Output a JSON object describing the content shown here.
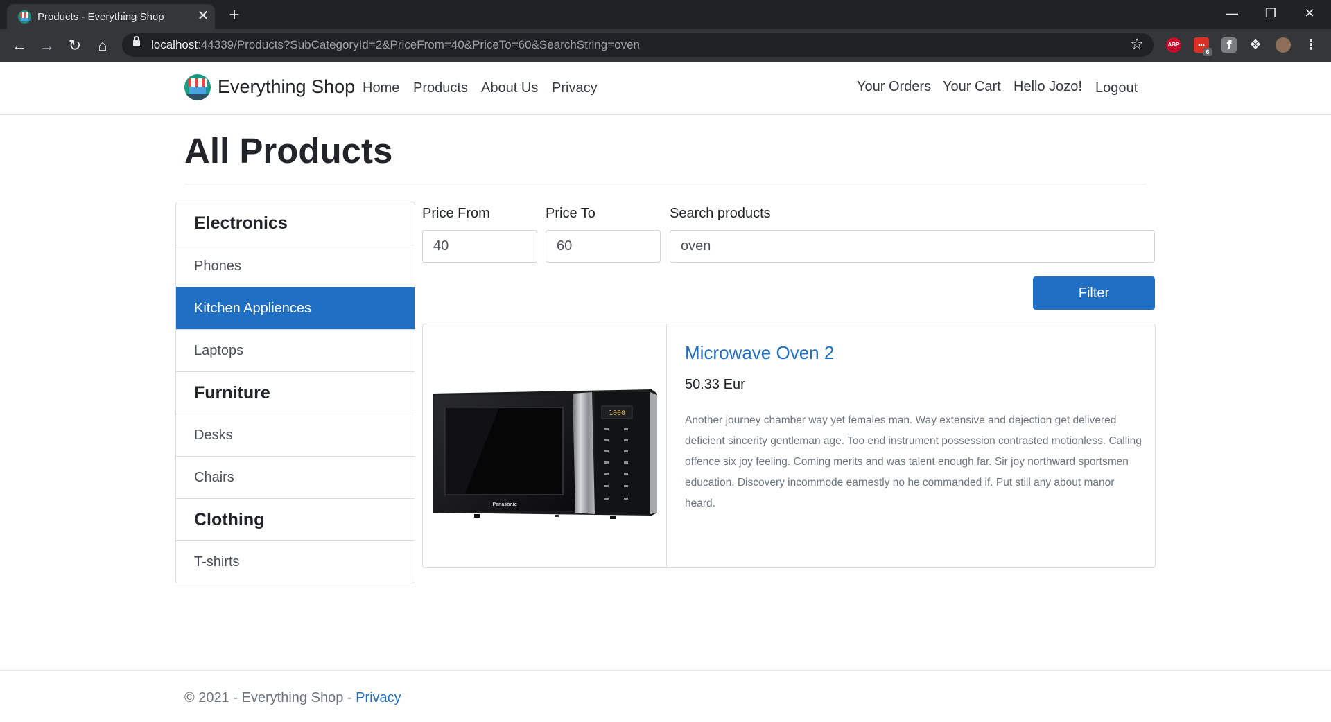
{
  "browser": {
    "tab_title": "Products - Everything Shop",
    "new_tab": "+",
    "close_tab": "✕",
    "url_host": "localhost",
    "url_rest": ":44339/Products?SubCategoryId=2&PriceFrom=40&PriceTo=60&SearchString=oven",
    "extensions": {
      "abp": "ABP",
      "calendar_badge": "6",
      "facebook": "f"
    }
  },
  "nav": {
    "brand": "Everything Shop",
    "links": [
      "Home",
      "Products",
      "About Us",
      "Privacy"
    ],
    "right_links": [
      "Your Orders",
      "Your Cart",
      "Hello Jozo!",
      "Logout"
    ]
  },
  "page": {
    "title": "All Products"
  },
  "sidebar": {
    "items": [
      {
        "label": "Electronics",
        "type": "category"
      },
      {
        "label": "Phones",
        "type": "subcategory"
      },
      {
        "label": "Kitchen Appliences",
        "type": "subcategory",
        "active": true
      },
      {
        "label": "Laptops",
        "type": "subcategory"
      },
      {
        "label": "Furniture",
        "type": "category"
      },
      {
        "label": "Desks",
        "type": "subcategory"
      },
      {
        "label": "Chairs",
        "type": "subcategory"
      },
      {
        "label": "Clothing",
        "type": "category"
      },
      {
        "label": "T-shirts",
        "type": "subcategory"
      }
    ]
  },
  "filters": {
    "price_from_label": "Price From",
    "price_from_value": "40",
    "price_to_label": "Price To",
    "price_to_value": "60",
    "search_label": "Search products",
    "search_value": "oven",
    "filter_button": "Filter"
  },
  "products": [
    {
      "name": "Microwave Oven 2",
      "price": "50.33 Eur",
      "description": "Another journey chamber way yet females man. Way extensive and dejection get delivered deficient sincerity gentleman age. Too end instrument possession contrasted motionless. Calling offence six joy feeling. Coming merits and was talent enough far. Sir joy northward sportsmen education. Discovery incommode earnestly no he commanded if. Put still any about manor heard.",
      "image_brand_text": "Panasonic",
      "image_display_text": "1000"
    }
  ],
  "footer": {
    "text": "© 2021 - Everything Shop - ",
    "link": "Privacy"
  },
  "colors": {
    "primary": "#1f6fc5",
    "browser_dark": "#202124",
    "toolbar": "#35363a"
  }
}
